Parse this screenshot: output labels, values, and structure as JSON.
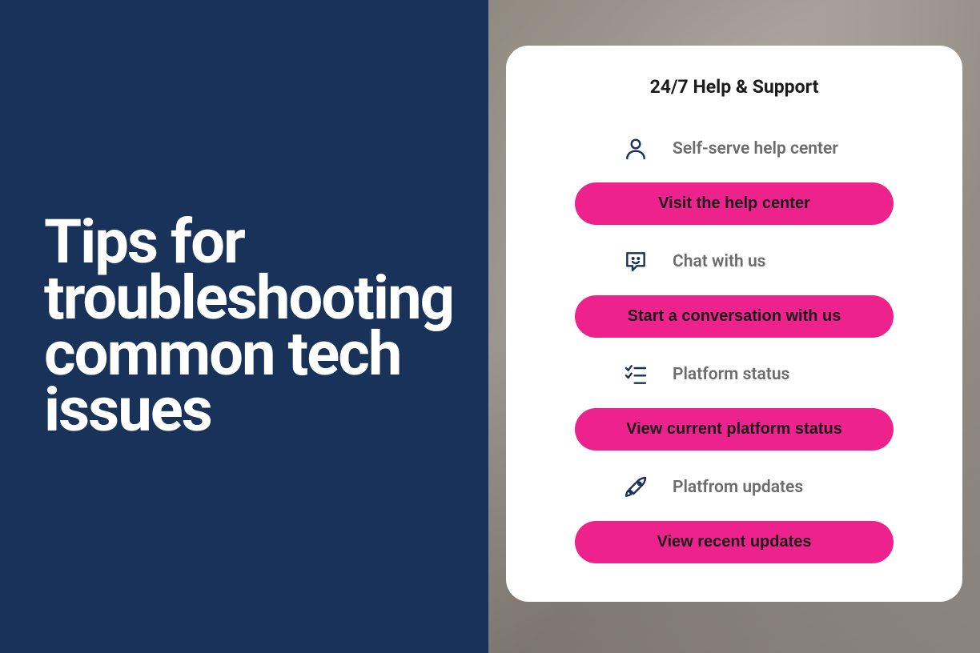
{
  "left": {
    "title": "Tips for troubleshooting common tech issues"
  },
  "card": {
    "title": "24/7 Help & Support",
    "sections": [
      {
        "label": "Self-serve help center",
        "cta": "Visit the help center"
      },
      {
        "label": "Chat with us",
        "cta": "Start a conversation with us"
      },
      {
        "label": "Platform status",
        "cta": "View current platform status"
      },
      {
        "label": "Platfrom updates",
        "cta": "View recent updates"
      }
    ]
  }
}
